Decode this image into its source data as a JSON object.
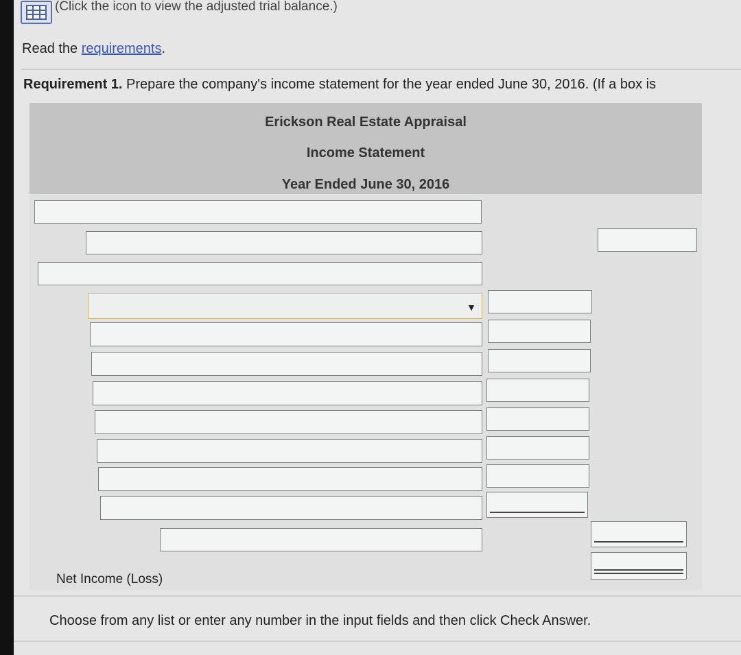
{
  "top": {
    "note": "(Click the icon to view the adjusted trial balance.)",
    "icon": "table-grid-icon"
  },
  "requirements_line": {
    "prefix": "Read the ",
    "link": "requirements",
    "suffix": "."
  },
  "requirement1": {
    "label": "Requirement 1.",
    "text": " Prepare the company's income statement for the year ended June 30, 2016. (If a box is"
  },
  "statement": {
    "company": "Erickson Real Estate Appraisal",
    "title": "Income Statement",
    "period": "Year Ended June 30, 2016",
    "net_income_label": "Net Income (Loss)"
  },
  "footer": {
    "instruction": "Choose from any list or enter any number in the input fields and then click Check Answer."
  }
}
